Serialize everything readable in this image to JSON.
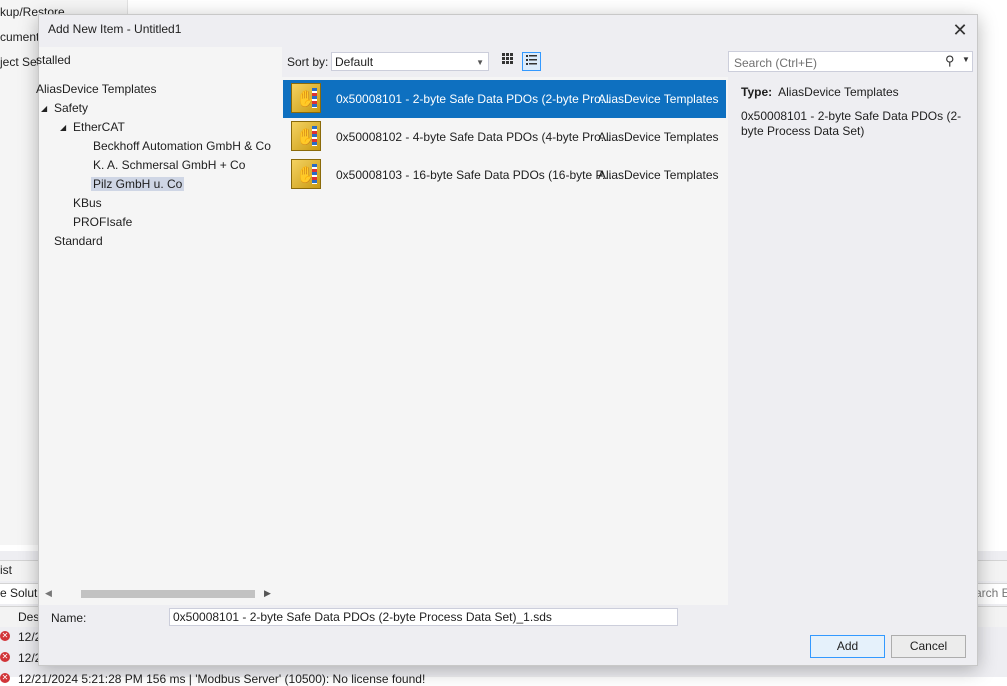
{
  "background": {
    "left_items": [
      "kup/Restore",
      "cument",
      "ject Set"
    ],
    "tab_label": "ist",
    "solution_label": "e Soluti",
    "search_right": "arch E",
    "col_header": "Des",
    "rows": [
      "12/2",
      "12/2",
      "12/21/2024 5:21:28 PM 156 ms | 'Modbus Server' (10500): No license found!"
    ]
  },
  "dialog": {
    "title": "Add New Item - Untitled1",
    "close_glyph": "✕",
    "tree": {
      "root_label": "stalled",
      "items": [
        {
          "label": "AliasDevice Templates"
        },
        {
          "label": "Safety",
          "expander": "◢"
        },
        {
          "label": "EtherCAT",
          "expander": "◢"
        },
        {
          "label": "Beckhoff Automation GmbH & Co"
        },
        {
          "label": "K. A. Schmersal GmbH + Co"
        },
        {
          "label": "Pilz GmbH u. Co"
        },
        {
          "label": "KBus"
        },
        {
          "label": "PROFIsafe"
        },
        {
          "label": "Standard"
        }
      ]
    },
    "toolbar": {
      "sort_label": "Sort by:",
      "sort_value": "Default",
      "search_placeholder": "Search (Ctrl+E)"
    },
    "list": [
      {
        "name": "0x50008101 - 2-byte Safe Data PDOs (2-byte Pro...",
        "category": "AliasDevice Templates"
      },
      {
        "name": "0x50008102 - 4-byte Safe Data PDOs (4-byte Pro...",
        "category": "AliasDevice Templates"
      },
      {
        "name": "0x50008103 - 16-byte Safe Data PDOs (16-byte P...",
        "category": "AliasDevice Templates"
      }
    ],
    "details": {
      "type_label": "Type:",
      "type_value": "AliasDevice Templates",
      "description": "0x50008101 - 2-byte Safe Data PDOs (2-byte Process Data Set)"
    },
    "name_label": "Name:",
    "name_value": "0x50008101 - 2-byte Safe Data PDOs (2-byte Process Data Set)_1.sds",
    "add_label": "Add",
    "cancel_label": "Cancel",
    "accent_color": "#0e70c0"
  }
}
